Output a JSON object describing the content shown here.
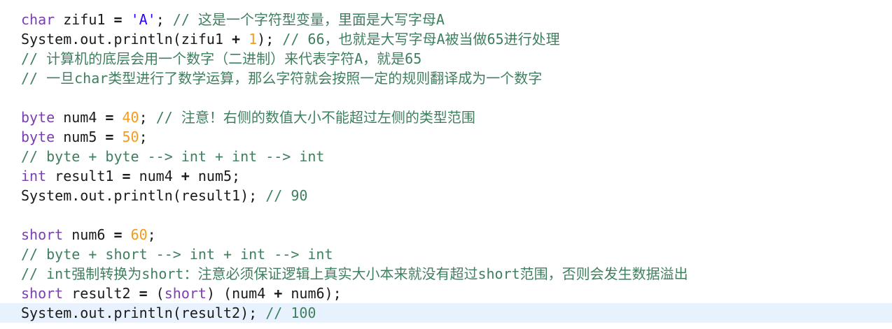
{
  "code_lines": [
    [
      "char",
      " zifu1 ",
      "=",
      " ",
      "'A'",
      "; ",
      "// 这是一个字符型变量，里面是大写字母A"
    ],
    [
      "System.out.println(zifu1 ",
      "+",
      " ",
      "1",
      "); ",
      "// 66，也就是大写字母A被当做65进行处理"
    ],
    [
      "// 计算机的底层会用一个数字（二进制）来代表字符A，就是65"
    ],
    [
      "// 一旦char类型进行了数学运算，那么字符就会按照一定的规则翻译成为一个数字"
    ],
    [],
    [
      "byte",
      " num4 ",
      "=",
      " ",
      "40",
      "; ",
      "// 注意！右侧的数值大小不能超过左侧的类型范围"
    ],
    [
      "byte",
      " num5 ",
      "=",
      " ",
      "50",
      ";"
    ],
    [
      "// byte + byte --> int + int --> int"
    ],
    [
      "int",
      " result1 ",
      "=",
      " num4 ",
      "+",
      " num5;"
    ],
    [
      "System.out.println(result1); ",
      "// 90"
    ],
    [],
    [
      "short",
      " num6 ",
      "=",
      " ",
      "60",
      ";"
    ],
    [
      "// byte + short --> int + int --> int"
    ],
    [
      "// int强制转换为short：注意必须保证逻辑上真实大小本来就没有超过short范围，否则会发生数据溢出"
    ],
    [
      "short",
      " result2 ",
      "=",
      " (",
      "short",
      ") (num4 ",
      "+",
      " num6);"
    ],
    [
      "System.out.println(result2); ",
      "// 100"
    ]
  ]
}
